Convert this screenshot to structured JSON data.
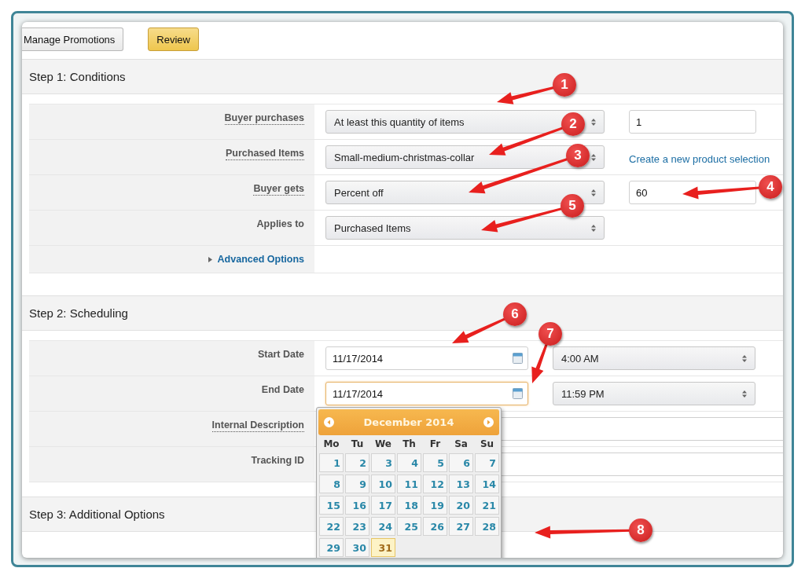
{
  "toolbar": {
    "buttons": [
      {
        "label": "Manage Promotions",
        "kind": "plain"
      },
      {
        "label": "Review",
        "kind": "primary"
      }
    ]
  },
  "steps": [
    {
      "title": "Step 1: Conditions",
      "rows": [
        {
          "label": "Buyer purchases",
          "help": true,
          "kind": "select-input",
          "value": "At least this quantity of items",
          "extra": "1"
        },
        {
          "label": "Purchased Items",
          "help": true,
          "kind": "select-link",
          "value": "Small-medium-christmas-collar",
          "extra": "Create a new product selection"
        },
        {
          "label": "Buyer gets",
          "help": true,
          "kind": "select-input",
          "value": "Percent off",
          "extra": "60"
        },
        {
          "label": "Applies to",
          "help": false,
          "kind": "select",
          "value": "Purchased Items"
        },
        {
          "label": "Advanced Options",
          "kind": "toggle",
          "expanded": false
        }
      ]
    },
    {
      "title": "Step 2: Scheduling",
      "rows": [
        {
          "label": "Start Date",
          "help": false,
          "kind": "date-time",
          "value": "11/17/2014",
          "extra": "4:00 AM",
          "focused": false
        },
        {
          "label": "End Date",
          "help": false,
          "kind": "date-time",
          "value": "11/17/2014",
          "extra": "11:59 PM",
          "focused": true
        },
        {
          "label": "Internal Description",
          "help": true,
          "kind": "text"
        },
        {
          "label": "Tracking ID",
          "help": false,
          "kind": "text"
        }
      ]
    },
    {
      "title": "Step 3: Additional Options"
    }
  ],
  "calendar": {
    "month": "December 2014",
    "weekdays": [
      "Mo",
      "Tu",
      "We",
      "Th",
      "Fr",
      "Sa",
      "Su"
    ],
    "days": [
      {
        "label": "1",
        "selected": false
      },
      {
        "label": "2",
        "selected": false
      },
      {
        "label": "3",
        "selected": false
      },
      {
        "label": "4",
        "selected": false
      },
      {
        "label": "5",
        "selected": false
      },
      {
        "label": "6",
        "selected": false
      },
      {
        "label": "7",
        "selected": false
      },
      {
        "label": "8",
        "selected": false
      },
      {
        "label": "9",
        "selected": false
      },
      {
        "label": "10",
        "selected": false
      },
      {
        "label": "11",
        "selected": false
      },
      {
        "label": "12",
        "selected": false
      },
      {
        "label": "13",
        "selected": false
      },
      {
        "label": "14",
        "selected": false
      },
      {
        "label": "15",
        "selected": false
      },
      {
        "label": "16",
        "selected": false
      },
      {
        "label": "17",
        "selected": false
      },
      {
        "label": "18",
        "selected": false
      },
      {
        "label": "19",
        "selected": false
      },
      {
        "label": "20",
        "selected": false
      },
      {
        "label": "21",
        "selected": false
      },
      {
        "label": "22",
        "selected": false
      },
      {
        "label": "23",
        "selected": false
      },
      {
        "label": "24",
        "selected": false
      },
      {
        "label": "25",
        "selected": false
      },
      {
        "label": "26",
        "selected": false
      },
      {
        "label": "27",
        "selected": false
      },
      {
        "label": "28",
        "selected": false
      },
      {
        "label": "29",
        "selected": false
      },
      {
        "label": "30",
        "selected": false
      },
      {
        "label": "31",
        "selected": true
      }
    ]
  },
  "annotations": [
    {
      "number": "1"
    },
    {
      "number": "2"
    },
    {
      "number": "3"
    },
    {
      "number": "4"
    },
    {
      "number": "5"
    },
    {
      "number": "6"
    },
    {
      "number": "7"
    },
    {
      "number": "8"
    }
  ]
}
